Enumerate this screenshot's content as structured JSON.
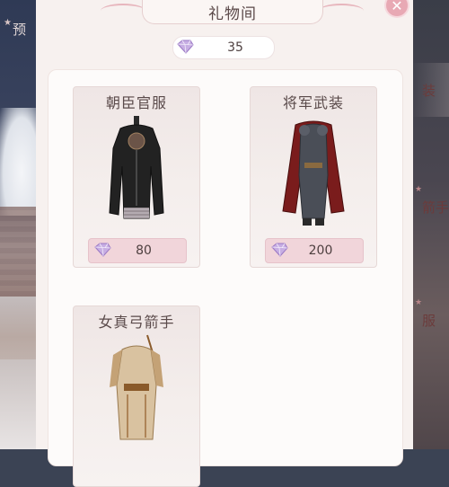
{
  "title": "礼物间",
  "currency": {
    "icon": "gem-icon",
    "value": "35"
  },
  "side_tabs": {
    "left_partial": "预",
    "right": [
      "装",
      "箭手",
      "服"
    ]
  },
  "items": [
    {
      "name": "朝臣官服",
      "price": "80",
      "currency_icon": "gem-icon"
    },
    {
      "name": "将军武装",
      "price": "200",
      "currency_icon": "gem-icon"
    },
    {
      "name": "女真弓箭手",
      "price": "",
      "currency_icon": "gem-icon"
    }
  ],
  "colors": {
    "panel_bg": "#f7f1ef",
    "price_bg": "#f1d5da",
    "accent_pink": "#e8a9b4",
    "gem_purple": "#b99ad6"
  }
}
